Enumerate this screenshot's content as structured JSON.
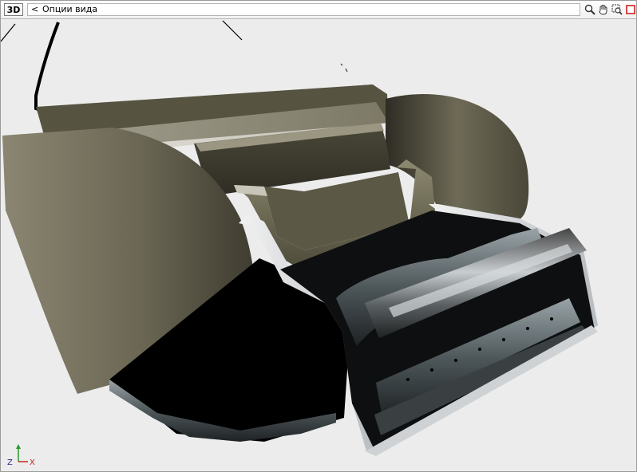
{
  "toolbar": {
    "view_mode_label": "3D",
    "back_symbol": "<",
    "view_options_label": "Опции вида",
    "tools": [
      {
        "name": "zoom-icon"
      },
      {
        "name": "pan-hand-icon"
      },
      {
        "name": "zoom-window-icon"
      },
      {
        "name": "close-view-icon"
      }
    ]
  },
  "axes": {
    "z": "Z",
    "x": "X"
  },
  "colors": {
    "toolbar_bg": "#f4f4f4",
    "viewport_bg": "#ececec",
    "model_olive": "#6e6a58",
    "model_dark": "#000000",
    "model_steel": "#8a9aa0",
    "axis_z": "#2a9a2a",
    "axis_x": "#cc2222",
    "close_icon": "#cc2222"
  }
}
